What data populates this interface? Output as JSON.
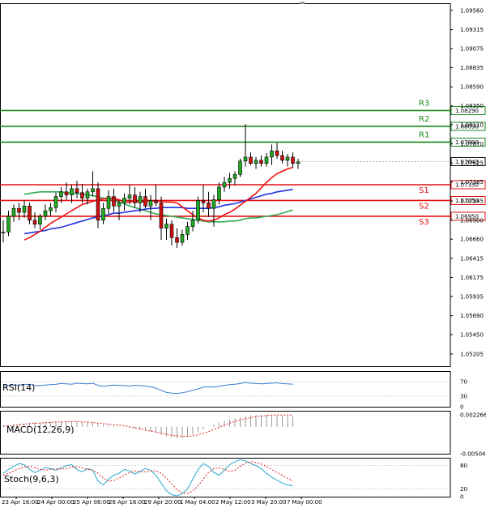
{
  "chart_data": [
    {
      "type": "candlestick",
      "panel": "main",
      "ylim": [
        1.0505,
        1.0965
      ],
      "y_ticks": [
        "1.09560",
        "1.09315",
        "1.09075",
        "1.08835",
        "1.08590",
        "1.08350",
        "1.08110",
        "1.07870",
        "1.07625",
        "1.07385",
        "1.07145",
        "1.06900",
        "1.06660",
        "1.06415",
        "1.06175",
        "1.05935",
        "1.05690",
        "1.05450",
        "1.05205"
      ],
      "x_ticks": [
        "23 Apr 16:00",
        "24 Apr 00:00",
        "25 Apr 08:00",
        "26 Apr 16:00",
        "29 Apr 20:00",
        "1 May 04:00",
        "2 May 12:00",
        "3 May 20:00",
        "7 May 00:00"
      ],
      "current_price": "1.07643",
      "levels": [
        {
          "name": "R3",
          "value": 1.0829,
          "label": "1.08290",
          "color": "#1a8a1a"
        },
        {
          "name": "R2",
          "value": 1.0809,
          "label": "1.08090",
          "color": "#1a8a1a"
        },
        {
          "name": "R1",
          "value": 1.0789,
          "label": "1.07890",
          "color": "#1a8a1a"
        },
        {
          "name": "S1",
          "value": 1.0735,
          "label": "1.07350",
          "color": "#e01010"
        },
        {
          "name": "S2",
          "value": 1.0715,
          "label": "1.07150",
          "color": "#e01010"
        },
        {
          "name": "S3",
          "value": 1.0695,
          "label": "1.06950",
          "color": "#e01010"
        }
      ],
      "candles": [
        [
          1.0674,
          1.069,
          1.0662,
          1.0675
        ],
        [
          1.0675,
          1.0702,
          1.067,
          1.0695
        ],
        [
          1.0695,
          1.071,
          1.0688,
          1.0705
        ],
        [
          1.0705,
          1.0712,
          1.069,
          1.07
        ],
        [
          1.07,
          1.0715,
          1.0693,
          1.0708
        ],
        [
          1.0708,
          1.0712,
          1.0685,
          1.069
        ],
        [
          1.069,
          1.07,
          1.068,
          1.0685
        ],
        [
          1.0685,
          1.0698,
          1.0678,
          1.0695
        ],
        [
          1.0695,
          1.071,
          1.069,
          1.0702
        ],
        [
          1.0702,
          1.0712,
          1.0695,
          1.0706
        ],
        [
          1.0706,
          1.0725,
          1.07,
          1.072
        ],
        [
          1.072,
          1.0732,
          1.0712,
          1.0726
        ],
        [
          1.0726,
          1.0738,
          1.0716,
          1.0722
        ],
        [
          1.0722,
          1.0735,
          1.0712,
          1.073
        ],
        [
          1.073,
          1.074,
          1.0718,
          1.0725
        ],
        [
          1.0725,
          1.0736,
          1.0712,
          1.0718
        ],
        [
          1.0718,
          1.073,
          1.071,
          1.0726
        ],
        [
          1.0726,
          1.0752,
          1.072,
          1.073
        ],
        [
          1.073,
          1.0738,
          1.068,
          1.069
        ],
        [
          1.069,
          1.0712,
          1.0685,
          1.0705
        ],
        [
          1.0705,
          1.0728,
          1.0698,
          1.072
        ],
        [
          1.072,
          1.073,
          1.07,
          1.0708
        ],
        [
          1.0708,
          1.0715,
          1.069,
          1.0712
        ],
        [
          1.0712,
          1.0724,
          1.0702,
          1.0718
        ],
        [
          1.0718,
          1.0735,
          1.071,
          1.0722
        ],
        [
          1.0722,
          1.0732,
          1.0706,
          1.0712
        ],
        [
          1.0712,
          1.0726,
          1.07,
          1.072
        ],
        [
          1.072,
          1.073,
          1.0705,
          1.0708
        ],
        [
          1.0708,
          1.0722,
          1.069,
          1.0715
        ],
        [
          1.0715,
          1.0735,
          1.0708,
          1.0712
        ],
        [
          1.0712,
          1.072,
          1.0665,
          1.068
        ],
        [
          1.068,
          1.0692,
          1.0665,
          1.0685
        ],
        [
          1.0685,
          1.069,
          1.0658,
          1.0668
        ],
        [
          1.0668,
          1.068,
          1.0655,
          1.0662
        ],
        [
          1.0662,
          1.0678,
          1.0658,
          1.0672
        ],
        [
          1.0672,
          1.0688,
          1.0665,
          1.0682
        ],
        [
          1.0682,
          1.0702,
          1.0676,
          1.069
        ],
        [
          1.069,
          1.072,
          1.0686,
          1.0715
        ],
        [
          1.0715,
          1.0735,
          1.07,
          1.0712
        ],
        [
          1.0712,
          1.0726,
          1.0694,
          1.0705
        ],
        [
          1.0705,
          1.0722,
          1.0682,
          1.0716
        ],
        [
          1.0716,
          1.0738,
          1.071,
          1.0732
        ],
        [
          1.0732,
          1.0745,
          1.0726,
          1.0738
        ],
        [
          1.0738,
          1.075,
          1.073,
          1.0743
        ],
        [
          1.0743,
          1.0752,
          1.0735,
          1.0748
        ],
        [
          1.0748,
          1.0768,
          1.0745,
          1.0765
        ],
        [
          1.0765,
          1.0812,
          1.0758,
          1.077
        ],
        [
          1.077,
          1.0776,
          1.076,
          1.0762
        ],
        [
          1.0762,
          1.077,
          1.0755,
          1.0766
        ],
        [
          1.0766,
          1.0772,
          1.0758,
          1.0762
        ],
        [
          1.0762,
          1.0775,
          1.0758,
          1.077
        ],
        [
          1.077,
          1.0786,
          1.076,
          1.0778
        ],
        [
          1.0778,
          1.0788,
          1.0768,
          1.0772
        ],
        [
          1.0772,
          1.0778,
          1.0762,
          1.0766
        ],
        [
          1.0766,
          1.0774,
          1.0758,
          1.077
        ],
        [
          1.077,
          1.0776,
          1.0756,
          1.0762
        ],
        [
          1.0762,
          1.0768,
          1.0755,
          1.0764
        ]
      ],
      "ma_red": [
        1.0665,
        1.0668,
        1.0672,
        1.0676,
        1.0681,
        1.0686,
        1.069,
        1.0694,
        1.0698,
        1.0702,
        1.0706,
        1.071,
        1.0712,
        1.0714,
        1.0716,
        1.0717,
        1.0718,
        1.0718,
        1.0716,
        1.0713,
        1.0713,
        1.0714,
        1.0713,
        1.0714,
        1.0715,
        1.0714,
        1.0714,
        1.0713,
        1.0713,
        1.0712,
        1.0707,
        1.0702,
        1.0697,
        1.0693,
        1.069,
        1.0689,
        1.069,
        1.0693,
        1.0697,
        1.07,
        1.0704,
        1.0709,
        1.0714,
        1.0719,
        1.0724,
        1.0731,
        1.0738,
        1.0744,
        1.0749,
        1.0752,
        1.0755,
        1.0757
      ],
      "ma_blue": [
        1.0673,
        1.0674,
        1.0675,
        1.0676,
        1.0677,
        1.0679,
        1.068,
        1.0681,
        1.0683,
        1.0685,
        1.0687,
        1.0689,
        1.0691,
        1.0693,
        1.0694,
        1.0696,
        1.0697,
        1.0699,
        1.0699,
        1.07,
        1.0701,
        1.0702,
        1.0703,
        1.0704,
        1.0705,
        1.0705,
        1.0706,
        1.0706,
        1.0706,
        1.0706,
        1.0706,
        1.0705,
        1.0705,
        1.0705,
        1.0705,
        1.0705,
        1.0706,
        1.0707,
        1.0709,
        1.071,
        1.0711,
        1.0713,
        1.0715,
        1.0717,
        1.0719,
        1.0721,
        1.0723,
        1.0724,
        1.0726,
        1.0727,
        1.0728,
        1.0729
      ],
      "ma_green": [
        1.0723,
        1.0724,
        1.0725,
        1.0726,
        1.0726,
        1.0726,
        1.0726,
        1.0726,
        1.0725,
        1.0724,
        1.0724,
        1.0723,
        1.0722,
        1.0721,
        1.072,
        1.0718,
        1.0717,
        1.0715,
        1.0713,
        1.0711,
        1.0708,
        1.0706,
        1.0704,
        1.0702,
        1.07,
        1.0698,
        1.0697,
        1.0696,
        1.0695,
        1.0694,
        1.0693,
        1.0692,
        1.0691,
        1.069,
        1.0689,
        1.0688,
        1.0688,
        1.0688,
        1.0688,
        1.0689,
        1.0689,
        1.069,
        1.0692,
        1.0693,
        1.0693,
        1.0694,
        1.0695,
        1.0696,
        1.0697,
        1.0699,
        1.0701,
        1.0703
      ]
    },
    {
      "type": "line",
      "panel": "rsi",
      "name": "RSI(14)",
      "ylim": [
        0,
        100
      ],
      "y_ticks": [
        "70",
        "30",
        "0"
      ],
      "values": [
        58,
        60,
        61,
        60,
        62,
        63,
        60,
        59,
        61,
        62,
        63,
        65,
        64,
        63,
        66,
        65,
        64,
        66,
        60,
        57,
        59,
        61,
        60,
        59,
        58,
        60,
        59,
        58,
        56,
        52,
        46,
        40,
        38,
        37,
        39,
        42,
        46,
        50,
        55,
        56,
        55,
        57,
        60,
        62,
        63,
        65,
        68,
        66,
        65,
        64,
        65,
        66,
        67,
        65,
        64,
        63
      ]
    },
    {
      "type": "histogram+line",
      "panel": "macd",
      "name": "MACD(12,26,9)",
      "ylim": [
        -0.005046,
        0.003
      ],
      "y_ticks": [
        "0.002266",
        "-0.005046"
      ],
      "histogram": [
        0.0002,
        0.0003,
        0.0004,
        0.0005,
        0.0006,
        0.0007,
        0.0008,
        0.0008,
        0.0009,
        0.0009,
        0.001,
        0.001,
        0.001,
        0.001,
        0.001,
        0.0009,
        0.0009,
        0.0008,
        0.0006,
        0.0004,
        0.0003,
        0.0002,
        0.0001,
        0.0,
        -0.0002,
        -0.0004,
        -0.0006,
        -0.0008,
        -0.001,
        -0.0012,
        -0.0015,
        -0.0018,
        -0.002,
        -0.0021,
        -0.0021,
        -0.0019,
        -0.0015,
        -0.001,
        -0.0005,
        0.0,
        0.0004,
        0.0008,
        0.0011,
        0.0014,
        0.0016,
        0.0018,
        0.002,
        0.0021,
        0.0022,
        0.0022,
        0.0022,
        0.0021,
        0.0021,
        0.002,
        0.002,
        0.0019
      ],
      "signal": [
        0.0001,
        0.0002,
        0.0003,
        0.0004,
        0.0005,
        0.0006,
        0.0007,
        0.0007,
        0.0008,
        0.0008,
        0.0009,
        0.0009,
        0.0009,
        0.001,
        0.001,
        0.0009,
        0.0009,
        0.0008,
        0.0007,
        0.0006,
        0.0005,
        0.0004,
        0.0003,
        0.0002,
        0.0,
        -0.0002,
        -0.0004,
        -0.0006,
        -0.0008,
        -0.001,
        -0.0012,
        -0.0014,
        -0.0016,
        -0.0017,
        -0.0018,
        -0.0018,
        -0.0017,
        -0.0015,
        -0.0012,
        -0.0009,
        -0.0005,
        -0.0001,
        0.0003,
        0.0007,
        0.001,
        0.0013,
        0.0015,
        0.0017,
        0.0019,
        0.002,
        0.0021,
        0.0022,
        0.0022,
        0.0022,
        0.0022,
        0.0022
      ]
    },
    {
      "type": "line",
      "panel": "stoch",
      "name": "Stoch(9,6,3)",
      "ylim": [
        0,
        100
      ],
      "y_ticks": [
        "80",
        "20",
        "0"
      ],
      "main": [
        60,
        70,
        78,
        85,
        82,
        70,
        62,
        68,
        75,
        72,
        68,
        74,
        80,
        82,
        70,
        64,
        72,
        68,
        40,
        30,
        45,
        55,
        60,
        70,
        66,
        58,
        65,
        72,
        68,
        55,
        35,
        15,
        5,
        2,
        8,
        20,
        45,
        70,
        85,
        78,
        62,
        55,
        68,
        82,
        90,
        95,
        92,
        85,
        80,
        72,
        60,
        50,
        42,
        35,
        30,
        28
      ],
      "signal": [
        55,
        60,
        66,
        72,
        76,
        78,
        75,
        70,
        68,
        70,
        71,
        71,
        73,
        76,
        77,
        74,
        70,
        68,
        60,
        48,
        40,
        42,
        48,
        55,
        62,
        66,
        64,
        64,
        66,
        66,
        60,
        48,
        32,
        18,
        10,
        8,
        15,
        28,
        45,
        62,
        72,
        74,
        70,
        65,
        68,
        78,
        86,
        90,
        88,
        84,
        78,
        70,
        62,
        55,
        47,
        40
      ]
    }
  ]
}
